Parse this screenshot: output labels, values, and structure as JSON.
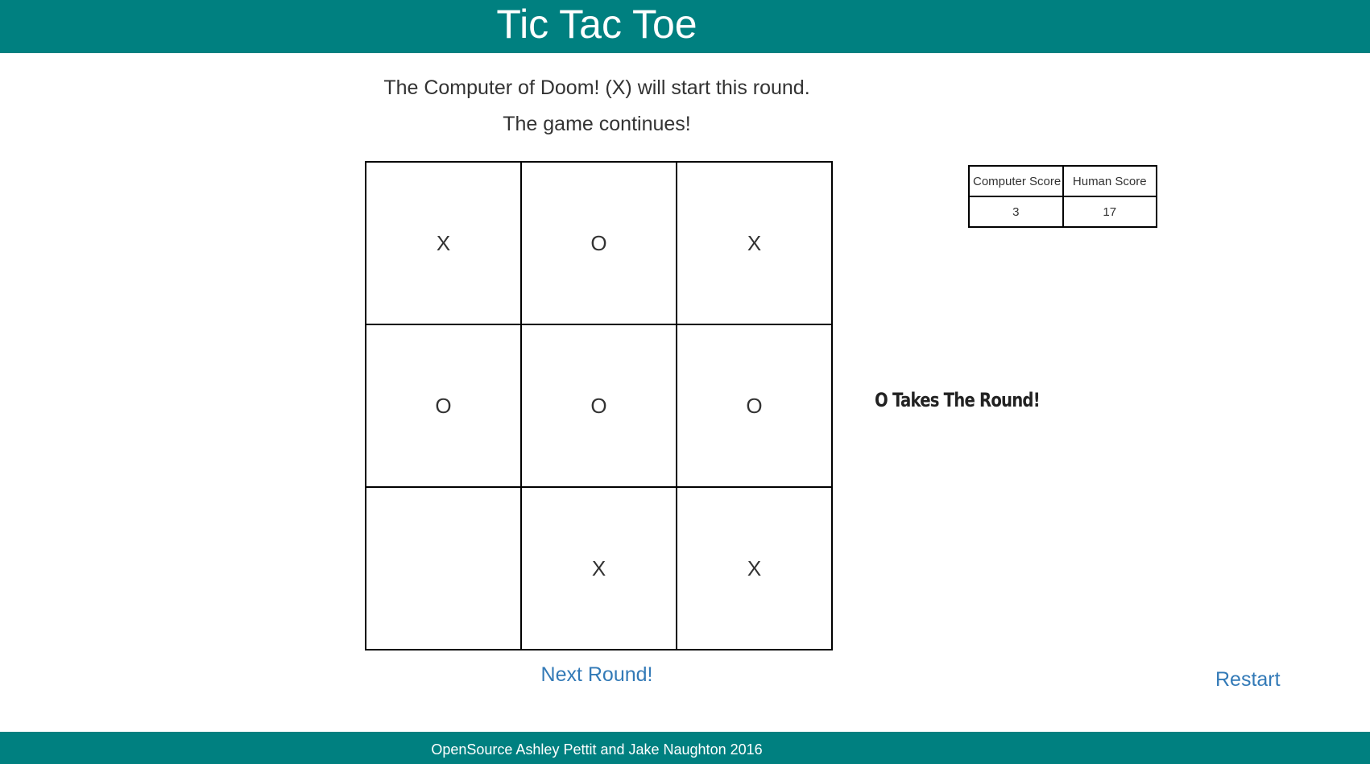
{
  "header": {
    "title": "Tic Tac Toe"
  },
  "status": {
    "line1": "The Computer of Doom! (X) will start this round.",
    "line2": "The game continues!"
  },
  "board": {
    "cells": [
      [
        "X",
        "O",
        "X"
      ],
      [
        "O",
        "O",
        "O"
      ],
      [
        "",
        "X",
        "X"
      ]
    ]
  },
  "scores": {
    "computer_label": "Computer Score",
    "human_label": "Human Score",
    "computer_value": "3",
    "human_value": "17"
  },
  "result": {
    "message": "O Takes The Round!"
  },
  "actions": {
    "next_round": "Next Round!",
    "restart": "Restart"
  },
  "footer": {
    "text": "OpenSource Ashley Pettit and Jake Naughton 2016"
  },
  "colors": {
    "brand": "#008080",
    "link": "#337ab7"
  }
}
